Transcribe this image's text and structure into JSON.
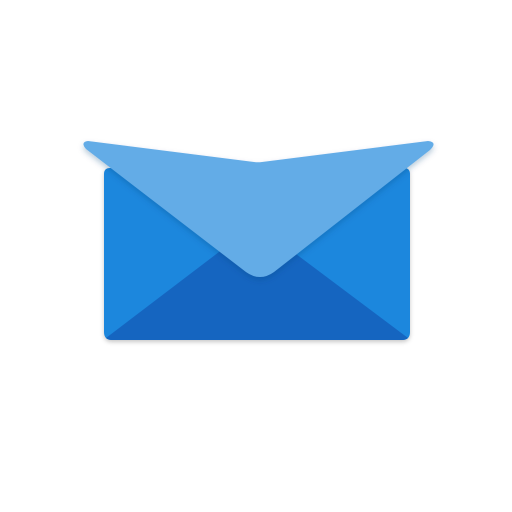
{
  "app": {
    "icon": "envelope-icon"
  },
  "colors": {
    "background": "#ffffff",
    "body_side": "#1f87dd",
    "body_bottom": "#1565c0",
    "flap_top": "#64ace7",
    "outline": "#2b7fd3"
  }
}
